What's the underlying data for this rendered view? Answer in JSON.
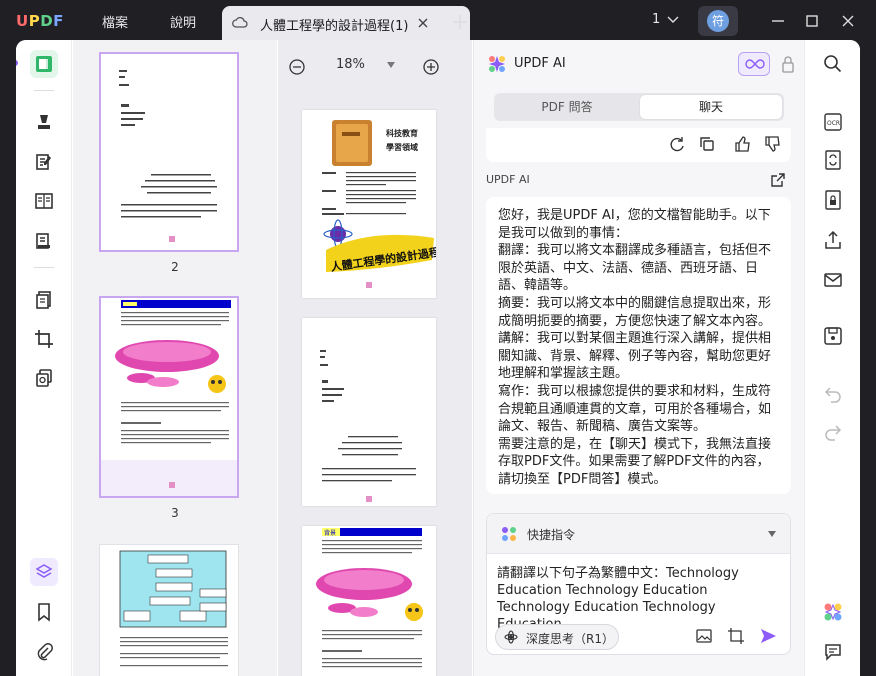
{
  "app": {
    "logo": "UPDF"
  },
  "menu": {
    "file": "檔案",
    "help": "說明"
  },
  "tab": {
    "title": "人體工程學的設計過程(1)"
  },
  "titlebar": {
    "page_count": "1",
    "avatar_text": "符"
  },
  "thumbnails": {
    "page_numbers": [
      "2",
      "3"
    ]
  },
  "docview": {
    "zoom": "18%"
  },
  "doc_content": {
    "cover_title_line1": "科技教育",
    "cover_title_line2": "學習領域",
    "cover_main_title": "人體工程學的設計過程",
    "flow_heading": "背景"
  },
  "ai": {
    "title": "UPDF AI",
    "seg_pdf": "PDF 問答",
    "seg_chat": "聊天",
    "sender": "UPDF AI",
    "answer": [
      "您好，我是UPDF AI，您的文檔智能助手。以下是我可以做到的事情：",
      "翻譯：我可以將文本翻譯成多種語言，包括但不限於英語、中文、法語、德語、西班牙語、日語、韓語等。",
      "摘要：我可以將文本中的關鍵信息提取出來，形成簡明扼要的摘要，方便您快速了解文本內容。",
      "講解：我可以對某個主題進行深入講解，提供相關知識、背景、解釋、例子等內容，幫助您更好地理解和掌握該主題。",
      "寫作：我可以根據您提供的要求和材料，生成符合規範且通順連貫的文章，可用於各種場合，如論文、報告、新聞稿、廣告文案等。",
      "需要注意的是，在【聊天】模式下，我無法直接存取PDF文件。如果需要了解PDF文件的內容，請切換至【PDF問答】模式。"
    ],
    "quick_commands": "快捷指令",
    "input_value": "請翻譯以下句子為繁體中文：Technology Education Technology Education Technology Education Technology Education",
    "deep_think": "深度思考（R1）"
  },
  "colors": {
    "accent": "#8b5cf6",
    "active_tool": "#2fb86a",
    "brand_green": "#5fd18b"
  }
}
